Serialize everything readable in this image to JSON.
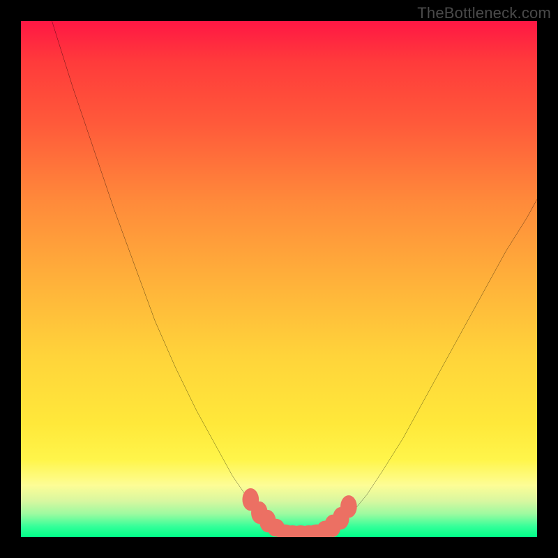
{
  "watermark": "TheBottleneck.com",
  "colors": {
    "frame": "#000000",
    "curve_stroke": "#000000",
    "marker_fill": "#ec7063",
    "bottom_band": "#00ff88"
  },
  "chart_data": {
    "type": "line",
    "title": "",
    "xlabel": "",
    "ylabel": "",
    "xlim": [
      0,
      100
    ],
    "ylim": [
      0,
      110
    ],
    "grid": false,
    "series": [
      {
        "name": "bottleneck-curve-left",
        "x": [
          6,
          10,
          14,
          18,
          22,
          26,
          30,
          34,
          38,
          41,
          43.5,
          45.5,
          47,
          48.2,
          49
        ],
        "values": [
          110,
          96,
          83,
          70,
          58,
          46,
          36,
          27,
          19,
          13,
          9,
          6,
          4,
          2.5,
          1.5
        ]
      },
      {
        "name": "bottleneck-curve-flat",
        "x": [
          49,
          51,
          53,
          55,
          57,
          59,
          60.5
        ],
        "values": [
          1.5,
          1,
          0.8,
          0.8,
          1,
          1.2,
          1.8
        ]
      },
      {
        "name": "bottleneck-curve-right",
        "x": [
          60.5,
          62,
          64,
          67,
          70,
          74,
          78,
          82,
          86,
          90,
          94,
          98,
          100
        ],
        "values": [
          1.8,
          3,
          5,
          9,
          14,
          21,
          29,
          37,
          45,
          53,
          61,
          68,
          72
        ]
      }
    ],
    "markers": {
      "name": "highlight-points",
      "x": [
        44.5,
        46.2,
        47.8,
        49.4,
        51,
        52.6,
        54.2,
        55.8,
        57.4,
        59,
        60.4,
        62,
        63.5
      ],
      "y": [
        8.0,
        5.2,
        3.4,
        2.0,
        1.2,
        1.0,
        1.0,
        1.0,
        1.2,
        1.6,
        2.4,
        4.0,
        6.5
      ],
      "rx": [
        1.6,
        1.6,
        1.6,
        1.7,
        2.1,
        2.2,
        2.2,
        2.2,
        2.1,
        1.7,
        1.6,
        1.6,
        1.6
      ],
      "ry": [
        2.4,
        2.4,
        2.4,
        1.9,
        1.5,
        1.5,
        1.5,
        1.5,
        1.5,
        1.9,
        2.4,
        2.4,
        2.4
      ]
    }
  }
}
